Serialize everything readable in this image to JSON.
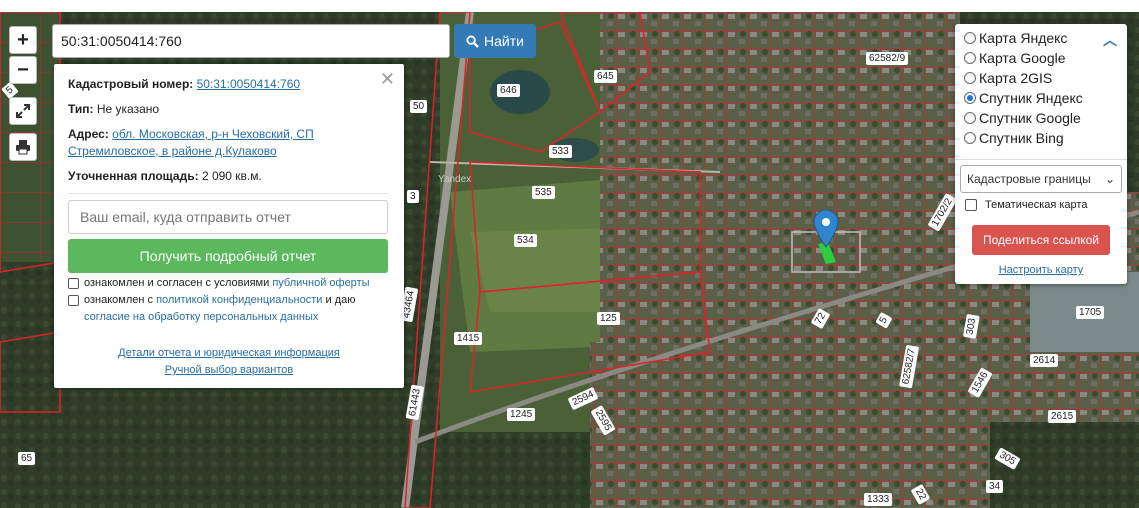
{
  "search": {
    "value": "50:31:0050414:760",
    "button_label": "Найти"
  },
  "zoom": {
    "in": "+",
    "out": "−"
  },
  "map_labels": [
    {
      "text": "5"
    },
    {
      "text": "50"
    },
    {
      "text": "646"
    },
    {
      "text": "645"
    },
    {
      "text": "533"
    },
    {
      "text": "535"
    },
    {
      "text": "3"
    },
    {
      "text": "534"
    },
    {
      "text": "62582/9"
    },
    {
      "text": "1702/2"
    },
    {
      "text": "125"
    },
    {
      "text": "72"
    },
    {
      "text": "5"
    },
    {
      "text": "303"
    },
    {
      "text": "1705"
    },
    {
      "text": "1415"
    },
    {
      "text": "43464"
    },
    {
      "text": "62582/7"
    },
    {
      "text": "1546"
    },
    {
      "text": "2614"
    },
    {
      "text": "2594"
    },
    {
      "text": "1245"
    },
    {
      "text": "2595"
    },
    {
      "text": "61443"
    },
    {
      "text": "2615"
    },
    {
      "text": "305"
    },
    {
      "text": "65"
    },
    {
      "text": "1333"
    },
    {
      "text": "34"
    },
    {
      "text": "22"
    }
  ],
  "map_watermark": "Yandex",
  "info": {
    "cadastral_label": "Кадастровый номер:",
    "cadastral_value": "50:31:0050414:760",
    "type_label": "Тип:",
    "type_value": "Не указано",
    "address_label": "Адрес:",
    "address_line1": "обл. Московская, р-н Чеховский, СП",
    "address_line2": "Стремиловское, в районе д.Кулаково",
    "area_label": "Уточненная площадь:",
    "area_value": "2 090 кв.м.",
    "email_placeholder": "Ваш email, куда отправить отчет",
    "report_button": "Получить подробный отчет",
    "agree1_prefix": "ознакомлен и согласен с условиями",
    "agree1_link": "публичной оферты",
    "agree2_prefix": "ознакомлен с",
    "agree2_link": "политикой конфиденциальности",
    "agree2_mid": "и даю",
    "agree2_link2": "согласие на обработку персональных данных",
    "details_link": "Детали отчета и юридическая информация",
    "manual_link": "Ручной выбор вариантов"
  },
  "layers": {
    "options": [
      {
        "label": "Карта Яндекс",
        "selected": false
      },
      {
        "label": "Карта Google",
        "selected": false
      },
      {
        "label": "Карта 2GIS",
        "selected": false
      },
      {
        "label": "Спутник Яндекс",
        "selected": true
      },
      {
        "label": "Спутник Google",
        "selected": false
      },
      {
        "label": "Спутник Bing",
        "selected": false
      }
    ],
    "overlay_select": "Кадастровые границы",
    "thematic_label": "Тематическая карта",
    "share_button": "Поделиться ссылкой",
    "setup_link": "Настроить карту"
  },
  "colors": {
    "search_button": "#337ab7",
    "report_button": "#5cb85c",
    "share_button": "#d9534f",
    "parcel_border": "#e0202a",
    "marker": "#2f86cf"
  }
}
